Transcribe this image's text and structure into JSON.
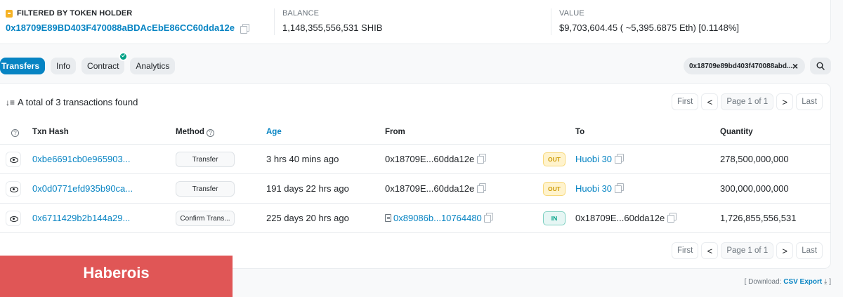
{
  "summary": {
    "filter_label": "FILTERED BY TOKEN HOLDER",
    "address": "0x18709E89BD403F470088aBDAcEbE86CC60dda12e",
    "balance_label": "BALANCE",
    "balance_value": "1,148,355,556,531 SHIB",
    "value_label": "VALUE",
    "value_value": "$9,703,604.45 ( ~5,395.6875 Eth) [0.1148%]"
  },
  "tabs": [
    {
      "label": "Transfers",
      "active": true
    },
    {
      "label": "Info",
      "active": false
    },
    {
      "label": "Contract",
      "active": false,
      "verified": true
    },
    {
      "label": "Analytics",
      "active": false
    }
  ],
  "filter_chip": {
    "text": "0x18709e89bd403f470088abd..."
  },
  "total_text": "A total of 3 transactions found",
  "pager": {
    "first": "First",
    "prev": "<",
    "page": "Page 1 of 1",
    "next": ">",
    "last": "Last"
  },
  "columns": {
    "txn_hash": "Txn Hash",
    "method": "Method",
    "age": "Age",
    "from": "From",
    "to": "To",
    "quantity": "Quantity"
  },
  "rows": [
    {
      "hash": "0xbe6691cb0e965903...",
      "method": "Transfer",
      "age": "3 hrs 40 mins ago",
      "from": "0x18709E...60dda12e",
      "from_is_link": false,
      "direction": "OUT",
      "to": "Huobi 30",
      "to_is_link": true,
      "quantity": "278,500,000,000"
    },
    {
      "hash": "0x0d0771efd935b90ca...",
      "method": "Transfer",
      "age": "191 days 22 hrs ago",
      "from": "0x18709E...60dda12e",
      "from_is_link": false,
      "direction": "OUT",
      "to": "Huobi 30",
      "to_is_link": true,
      "quantity": "300,000,000,000"
    },
    {
      "hash": "0x6711429b2b144a29...",
      "method": "Confirm Trans...",
      "age": "225 days 20 hrs ago",
      "from": "0x89086b...10764480",
      "from_is_link": true,
      "direction": "IN",
      "to": "0x18709E...60dda12e",
      "to_is_link": false,
      "quantity": "1,726,855,556,531"
    }
  ],
  "download": {
    "prefix": "[ Download:",
    "link": "CSV Export",
    "suffix": "]"
  },
  "overlay_label": "Haberois",
  "colors": {
    "accent": "#0784c3",
    "out_badge": "#cc9a06",
    "in_badge": "#00a186",
    "overlay": "#e05656"
  }
}
